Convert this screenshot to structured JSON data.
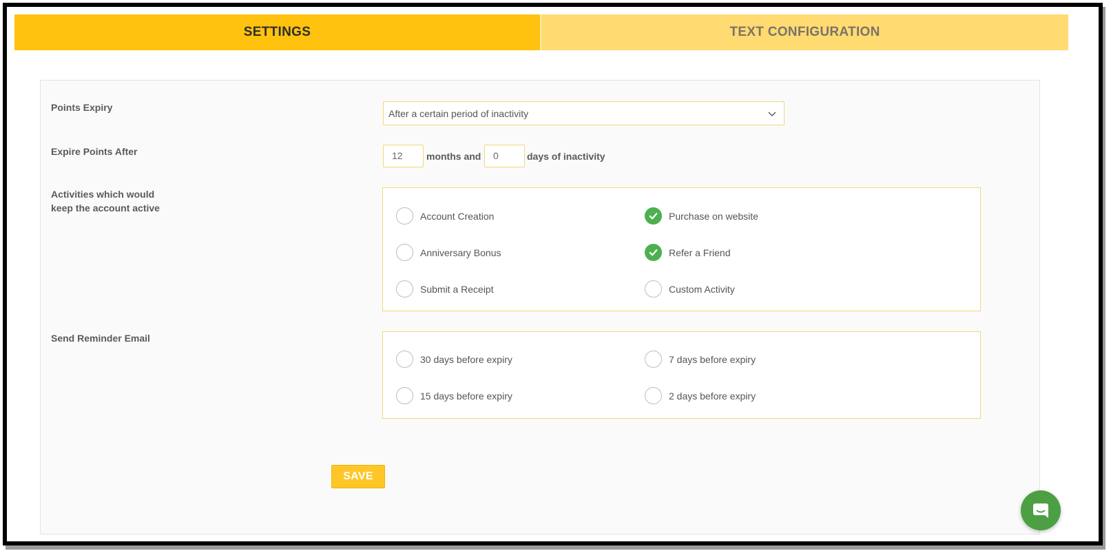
{
  "tabs": [
    {
      "label": "SETTINGS",
      "active": true
    },
    {
      "label": "TEXT CONFIGURATION",
      "active": false
    }
  ],
  "points_expiry": {
    "label": "Points Expiry",
    "selected": "After a certain period of inactivity",
    "icon": "chevron-down-icon"
  },
  "expire_after": {
    "label": "Expire Points After",
    "months_value": "12",
    "months_text": "months and",
    "days_value": "0",
    "days_text": "days of inactivity"
  },
  "activities": {
    "label_line1": "Activities which would",
    "label_line2": "keep the account active",
    "options": [
      {
        "label": "Account Creation",
        "checked": false
      },
      {
        "label": "Purchase on website",
        "checked": true
      },
      {
        "label": "Anniversary Bonus",
        "checked": false
      },
      {
        "label": "Refer a Friend",
        "checked": true
      },
      {
        "label": "Submit a Receipt",
        "checked": false
      },
      {
        "label": "Custom Activity",
        "checked": false
      }
    ]
  },
  "reminder": {
    "label": "Send Reminder Email",
    "options": [
      {
        "label": "30 days before expiry",
        "checked": false
      },
      {
        "label": "7 days before expiry",
        "checked": false
      },
      {
        "label": "15 days before expiry",
        "checked": false
      },
      {
        "label": "2 days before expiry",
        "checked": false
      }
    ]
  },
  "save_label": "SAVE",
  "colors": {
    "accent": "#ffc20e",
    "tab_inactive": "#ffdb72",
    "check_green": "#4db04f",
    "chat_green": "#4c9f43"
  },
  "chat_icon": "chat-bubble-icon"
}
